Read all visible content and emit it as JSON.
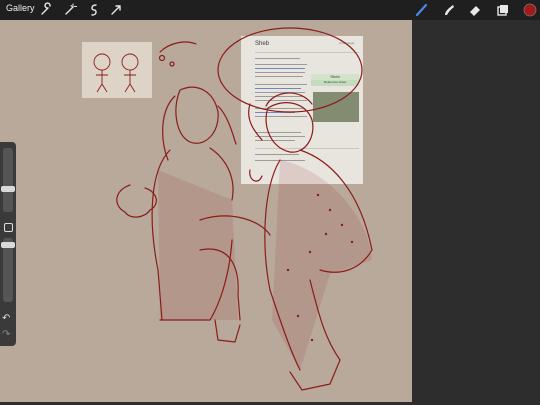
{
  "topbar": {
    "gallery_label": "Gallery",
    "left_tools": [
      "wrench-icon",
      "magic-wand-icon",
      "selection-icon",
      "transform-arrow-icon"
    ],
    "right_tools": [
      "brush-icon",
      "smudge-icon",
      "eraser-icon",
      "layers-icon",
      "color-swatch-icon"
    ],
    "active_tool": "brush-icon",
    "current_color": "#a11a1a",
    "brush_accent": "#4a8ae8"
  },
  "sidebar": {
    "size_slider": 0.65,
    "opacity_slider": 0.8,
    "buttons": [
      "modify-square-icon",
      "undo-icon",
      "redo-icon"
    ]
  },
  "canvas": {
    "background_color": "#b9a99a",
    "line_color": "#8b1c1c",
    "reference_card": {
      "title": "Sheb",
      "tag": "Ursatologia",
      "infobox_title": "Sheb",
      "infobox_sub": "Reference sheet"
    }
  }
}
